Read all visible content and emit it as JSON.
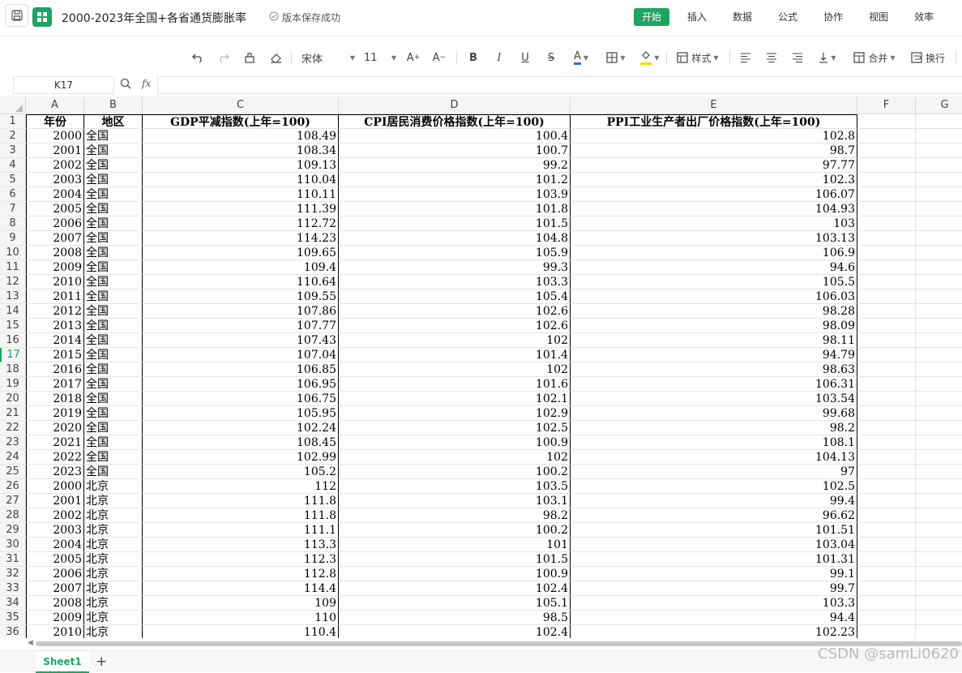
{
  "titlebar": {
    "title": "2000-2023年全国+各省通货膨胀率",
    "save_status": "版本保存成功",
    "menu": [
      "开始",
      "插入",
      "数据",
      "公式",
      "协作",
      "视图",
      "效率"
    ]
  },
  "toolbar": {
    "font_name": "宋体",
    "font_size": "11",
    "style_label": "样式",
    "merge_label": "合并",
    "wrap_label": "换行",
    "font_color": "#2f6fd6",
    "fill_color": "#f5d90a"
  },
  "formulabar": {
    "cell_ref": "K17",
    "fx": "fx",
    "value": ""
  },
  "columns": [
    "A",
    "B",
    "C",
    "D",
    "E",
    "F",
    "G"
  ],
  "table": {
    "headers": [
      "年份",
      "地区",
      "GDP平减指数(上年=100)",
      "CPI居民消费价格指数(上年=100)",
      "PPI工业生产者出厂价格指数(上年=100)"
    ],
    "rows": [
      [
        "2000",
        "全国",
        "108.49",
        "100.4",
        "102.8"
      ],
      [
        "2001",
        "全国",
        "108.34",
        "100.7",
        "98.7"
      ],
      [
        "2002",
        "全国",
        "109.13",
        "99.2",
        "97.77"
      ],
      [
        "2003",
        "全国",
        "110.04",
        "101.2",
        "102.3"
      ],
      [
        "2004",
        "全国",
        "110.11",
        "103.9",
        "106.07"
      ],
      [
        "2005",
        "全国",
        "111.39",
        "101.8",
        "104.93"
      ],
      [
        "2006",
        "全国",
        "112.72",
        "101.5",
        "103"
      ],
      [
        "2007",
        "全国",
        "114.23",
        "104.8",
        "103.13"
      ],
      [
        "2008",
        "全国",
        "109.65",
        "105.9",
        "106.9"
      ],
      [
        "2009",
        "全国",
        "109.4",
        "99.3",
        "94.6"
      ],
      [
        "2010",
        "全国",
        "110.64",
        "103.3",
        "105.5"
      ],
      [
        "2011",
        "全国",
        "109.55",
        "105.4",
        "106.03"
      ],
      [
        "2012",
        "全国",
        "107.86",
        "102.6",
        "98.28"
      ],
      [
        "2013",
        "全国",
        "107.77",
        "102.6",
        "98.09"
      ],
      [
        "2014",
        "全国",
        "107.43",
        "102",
        "98.11"
      ],
      [
        "2015",
        "全国",
        "107.04",
        "101.4",
        "94.79"
      ],
      [
        "2016",
        "全国",
        "106.85",
        "102",
        "98.63"
      ],
      [
        "2017",
        "全国",
        "106.95",
        "101.6",
        "106.31"
      ],
      [
        "2018",
        "全国",
        "106.75",
        "102.1",
        "103.54"
      ],
      [
        "2019",
        "全国",
        "105.95",
        "102.9",
        "99.68"
      ],
      [
        "2020",
        "全国",
        "102.24",
        "102.5",
        "98.2"
      ],
      [
        "2021",
        "全国",
        "108.45",
        "100.9",
        "108.1"
      ],
      [
        "2022",
        "全国",
        "102.99",
        "102",
        "104.13"
      ],
      [
        "2023",
        "全国",
        "105.2",
        "100.2",
        "97"
      ],
      [
        "2000",
        "北京",
        "112",
        "103.5",
        "102.5"
      ],
      [
        "2001",
        "北京",
        "111.8",
        "103.1",
        "99.4"
      ],
      [
        "2002",
        "北京",
        "111.8",
        "98.2",
        "96.62"
      ],
      [
        "2003",
        "北京",
        "111.1",
        "100.2",
        "101.51"
      ],
      [
        "2004",
        "北京",
        "113.3",
        "101",
        "103.04"
      ],
      [
        "2005",
        "北京",
        "112.3",
        "101.5",
        "101.31"
      ],
      [
        "2006",
        "北京",
        "112.8",
        "100.9",
        "99.1"
      ],
      [
        "2007",
        "北京",
        "114.4",
        "102.4",
        "99.7"
      ],
      [
        "2008",
        "北京",
        "109",
        "105.1",
        "103.3"
      ],
      [
        "2009",
        "北京",
        "110",
        "98.5",
        "94.4"
      ],
      [
        "2010",
        "北京",
        "110.4",
        "102.4",
        "102.23"
      ]
    ]
  },
  "active_row": 17,
  "sheets": [
    "Sheet1"
  ],
  "add_sheet": "+",
  "watermark": "CSDN @samLi0620"
}
